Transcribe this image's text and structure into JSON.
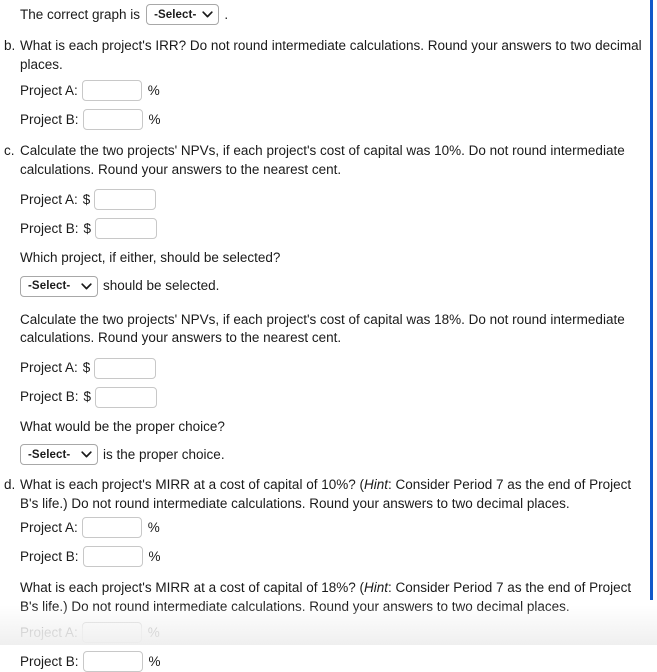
{
  "page": {
    "background_color": "#ffffff",
    "text_color": "#1a1a1a",
    "rail_color": "#1159c9"
  },
  "select_options": {
    "placeholder": "-Select-",
    "chevron_icon": "chevron-down-icon"
  },
  "graph_question": {
    "prefix": "The correct graph is",
    "select_value": "-Select-",
    "suffix": "."
  },
  "part_b": {
    "marker": "b.",
    "prompt": "What is each project's IRR? Do not round intermediate calculations. Round your answers to two decimal places.",
    "fields": [
      {
        "label": "Project A:",
        "value": "",
        "unit": "%"
      },
      {
        "label": "Project B:",
        "value": "",
        "unit": "%"
      }
    ]
  },
  "part_c": {
    "marker": "c.",
    "npv10": {
      "prompt": "Calculate the two projects' NPVs, if each project's cost of capital was 10%. Do not round intermediate calculations. Round your answers to the nearest cent.",
      "fields": [
        {
          "label": "Project A:",
          "currency": "$",
          "value": ""
        },
        {
          "label": "Project B:",
          "currency": "$",
          "value": ""
        }
      ],
      "follow_up": "Which project, if either, should be selected?",
      "select_value": "-Select-",
      "select_suffix": "should be selected."
    },
    "npv18": {
      "prompt": "Calculate the two projects' NPVs, if each project's cost of capital was 18%. Do not round intermediate calculations. Round your answers to the nearest cent.",
      "fields": [
        {
          "label": "Project A:",
          "currency": "$",
          "value": ""
        },
        {
          "label": "Project B:",
          "currency": "$",
          "value": ""
        }
      ],
      "follow_up": "What would be the proper choice?",
      "select_value": "-Select-",
      "select_suffix": "is the proper choice."
    }
  },
  "part_d": {
    "marker": "d.",
    "mirr10": {
      "prompt_before_hint": "What is each project's MIRR at a cost of capital of 10%? (",
      "hint_word": "Hint",
      "prompt_after_hint": ": Consider Period 7 as the end of Project B's life.) Do not round intermediate calculations. Round your answers to two decimal places.",
      "fields": [
        {
          "label": "Project A:",
          "value": "",
          "unit": "%"
        },
        {
          "label": "Project B:",
          "value": "",
          "unit": "%"
        }
      ]
    },
    "mirr18": {
      "prompt_before_hint": "What is each project's MIRR at a cost of capital of 18%? (",
      "hint_word": "Hint",
      "prompt_after_hint": ": Consider Period 7 as the end of Project B's life.) Do not round intermediate calculations. Round your answers to two decimal places.",
      "fields": [
        {
          "label": "Project A:",
          "value": "",
          "unit": "%"
        },
        {
          "label": "Project B:",
          "value": "",
          "unit": "%"
        }
      ]
    }
  }
}
